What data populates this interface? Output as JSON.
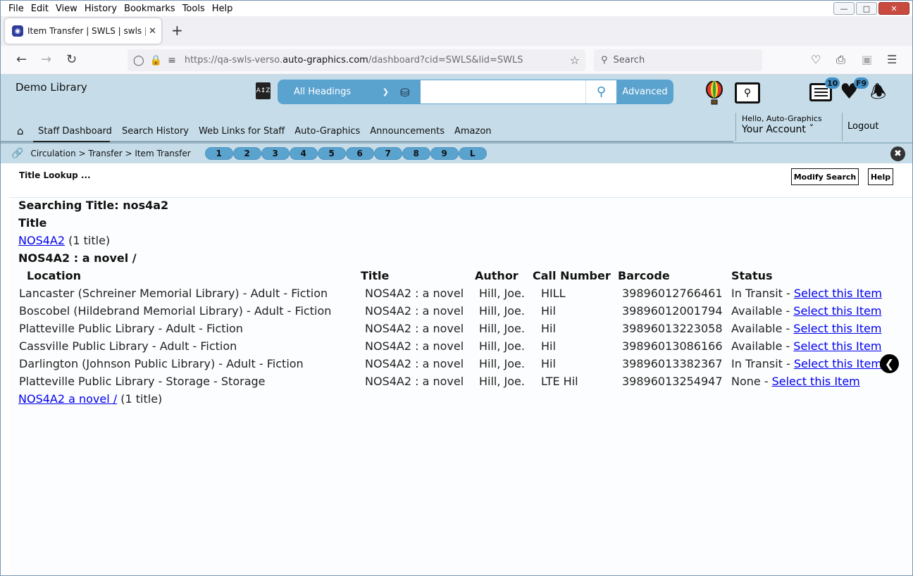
{
  "browser": {
    "menu": [
      "File",
      "Edit",
      "View",
      "History",
      "Bookmarks",
      "Tools",
      "Help"
    ],
    "tab_title": "Item Transfer | SWLS | swls | Auto-Graphics",
    "url_prefix": "https://qa-swls-verso.",
    "url_domain": "auto-graphics.com",
    "url_suffix": "/dashboard?cid=SWLS&lid=SWLS",
    "search_placeholder": "Search"
  },
  "header": {
    "library_name": "Demo Library",
    "heading_select": "All Headings",
    "advanced_label": "Advanced",
    "badge_list": "10",
    "badge_heart": "F9",
    "nav": [
      "Staff Dashboard",
      "Search History",
      "Web Links for Staff",
      "Auto-Graphics",
      "Announcements",
      "Amazon"
    ],
    "hello": "Hello, Auto-Graphics",
    "account": "Your Account",
    "logout": "Logout"
  },
  "breadcrumb": {
    "path": "Circulation > Transfer > Item Transfer",
    "pills": [
      "1",
      "2",
      "3",
      "4",
      "5",
      "6",
      "7",
      "8",
      "9",
      "L"
    ]
  },
  "page": {
    "title": "Title Lookup ...",
    "modify_search": "Modify Search",
    "help": "Help",
    "searching": "Searching Title: nos4a2",
    "title_heading": "Title",
    "result1_link": "NOS4A2",
    "result1_count": "(1 title)",
    "result1_heading": "NOS4A2 : a novel /",
    "result2_link": "NOS4A2 a novel /",
    "result2_count": "(1 title)",
    "columns": [
      "Location",
      "Title",
      "Author",
      "Call Number",
      "Barcode",
      "Status"
    ],
    "rows": [
      {
        "location": "Lancaster (Schreiner Memorial Library) - Adult - Fiction",
        "title": "NOS4A2 : a novel",
        "author": "Hill, Joe.",
        "call": "HILL",
        "barcode": "39896012766461",
        "status": "In Transit -",
        "action": "Select this Item"
      },
      {
        "location": "Boscobel (Hildebrand Memorial Library) - Adult - Fiction",
        "title": "NOS4A2 : a novel",
        "author": "Hill, Joe.",
        "call": "Hil",
        "barcode": "39896012001794",
        "status": "Available -",
        "action": "Select this Item"
      },
      {
        "location": "Platteville Public Library - Adult - Fiction",
        "title": "NOS4A2 : a novel",
        "author": "Hill, Joe.",
        "call": "Hil",
        "barcode": "39896013223058",
        "status": "Available -",
        "action": "Select this Item"
      },
      {
        "location": "Cassville Public Library - Adult - Fiction",
        "title": "NOS4A2 : a novel",
        "author": "Hill, Joe.",
        "call": "Hil",
        "barcode": "39896013086166",
        "status": "Available -",
        "action": "Select this Item"
      },
      {
        "location": "Darlington (Johnson Public Library) - Adult - Fiction",
        "title": "NOS4A2 : a novel",
        "author": "Hill, Joe.",
        "call": "Hil",
        "barcode": "39896013382367",
        "status": "In Transit -",
        "action": "Select this Item"
      },
      {
        "location": "Platteville Public Library - Storage - Storage",
        "title": "NOS4A2 : a novel",
        "author": "Hill, Joe.",
        "call": "LTE Hil",
        "barcode": "39896013254947",
        "status": "None -",
        "action": "Select this Item"
      }
    ]
  },
  "icons": [
    "app-favicon",
    "back-icon",
    "forward-icon",
    "reload-icon",
    "shield-icon",
    "lock-icon",
    "permissions-icon",
    "bookmark-star-icon",
    "pocket-icon",
    "print-icon",
    "extension-icon",
    "hamburger-icon",
    "az-icon",
    "database-icon",
    "search-icon",
    "balloon-icon",
    "reader-icon",
    "list-icon",
    "heart-icon",
    "bell-icon",
    "home-icon",
    "link-icon",
    "close-circle-icon",
    "back-arrow-icon"
  ],
  "colors": {
    "header_bg": "#c6dde9",
    "accent": "#5ba3cf",
    "link": "#0000ee"
  }
}
